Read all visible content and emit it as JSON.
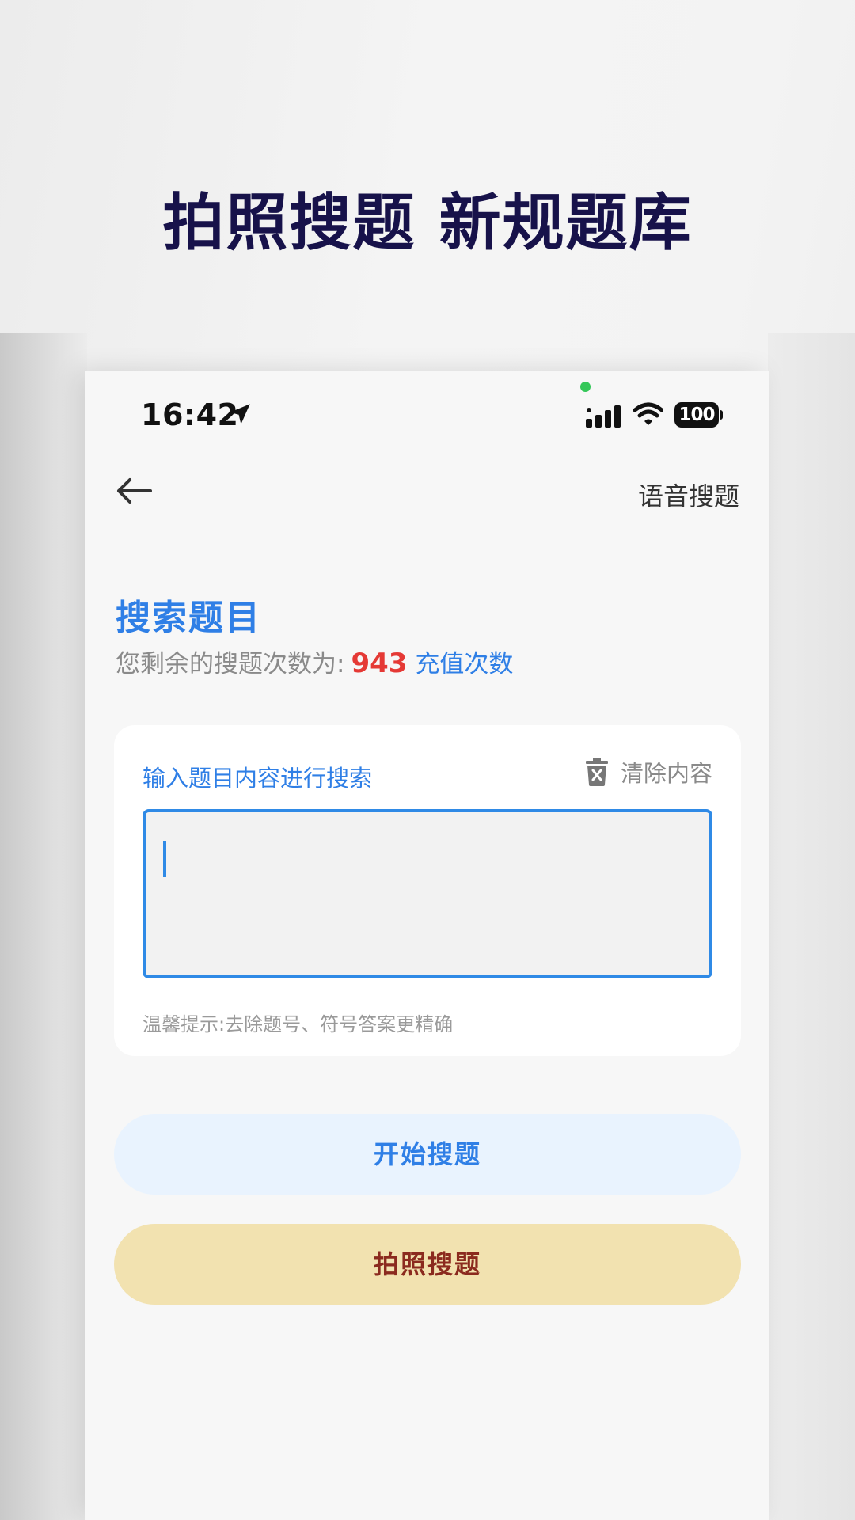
{
  "headline": "拍照搜题 新规题库",
  "status_bar": {
    "time": "16:42",
    "battery": "100",
    "icons": [
      "location-arrow-icon",
      "signal-icon",
      "wifi-icon",
      "battery-icon"
    ]
  },
  "nav": {
    "back_icon": "back-arrow-icon",
    "voice_search_label": "语音搜题"
  },
  "main": {
    "title": "搜索题目",
    "remaining_prefix": "您剩余的搜题次数为:",
    "remaining_count": "943",
    "recharge_label": "充值次数"
  },
  "card": {
    "input_label": "输入题目内容进行搜索",
    "clear_label": "清除内容",
    "input_value": "",
    "tip": "温馨提示:去除题号、符号答案更精确"
  },
  "buttons": {
    "start_search": "开始搜题",
    "photo_search": "拍照搜题"
  },
  "colors": {
    "accent": "#2f7fe6",
    "count_red": "#e53935",
    "headline": "#17124a",
    "photo_button_bg": "#f2e2b0",
    "photo_button_text": "#8b2a1e",
    "search_button_bg": "#e9f3fe"
  }
}
